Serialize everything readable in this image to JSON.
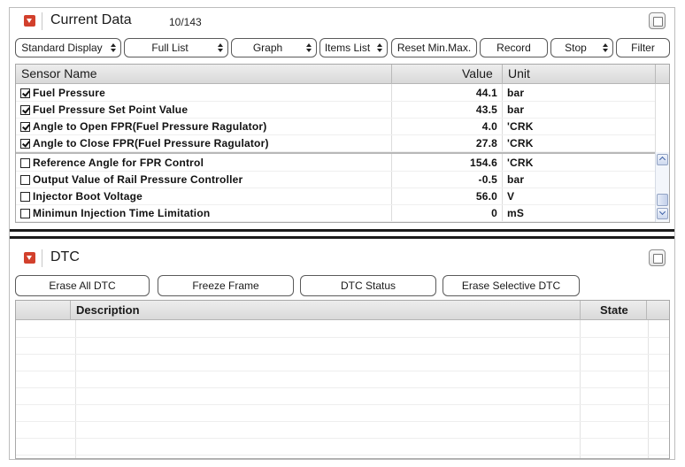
{
  "current_data": {
    "title": "Current Data",
    "count": "10/143",
    "toolbar": {
      "standard_display": "Standard Display",
      "full_list": "Full List",
      "graph": "Graph",
      "items_list": "Items List",
      "reset_min_max": "Reset Min.Max.",
      "record": "Record",
      "stop": "Stop",
      "filter": "Filter"
    },
    "columns": {
      "name": "Sensor Name",
      "value": "Value",
      "unit": "Unit"
    },
    "rows": [
      {
        "name": "Fuel Pressure",
        "value": "44.1",
        "unit": "bar",
        "checked": true
      },
      {
        "name": "Fuel Pressure Set Point Value",
        "value": "43.5",
        "unit": "bar",
        "checked": true
      },
      {
        "name": "Angle to Open FPR(Fuel Pressure Ragulator)",
        "value": "4.0",
        "unit": "'CRK",
        "checked": true
      },
      {
        "name": "Angle to Close FPR(Fuel Pressure Ragulator)",
        "value": "27.8",
        "unit": "'CRK",
        "checked": true
      },
      {
        "name": "Reference Angle for FPR Control",
        "value": "154.6",
        "unit": "'CRK",
        "checked": false
      },
      {
        "name": "Output Value of Rail Pressure Controller",
        "value": "-0.5",
        "unit": "bar",
        "checked": false
      },
      {
        "name": "Injector Boot Voltage",
        "value": "56.0",
        "unit": "V",
        "checked": false
      },
      {
        "name": "Minimun Injection Time Limitation",
        "value": "0",
        "unit": "mS",
        "checked": false
      }
    ]
  },
  "dtc": {
    "title": "DTC",
    "toolbar": {
      "erase_all": "Erase All DTC",
      "freeze_frame": "Freeze Frame",
      "dtc_status": "DTC Status",
      "erase_selective": "Erase Selective DTC"
    },
    "columns": {
      "description": "Description",
      "state": "State"
    }
  },
  "colors": {
    "collapse_button": "#d2402c",
    "header_gradient_top": "#ededed",
    "header_gradient_bottom": "#d9d9d9",
    "splitter": "#1c1c1c"
  },
  "icons": {
    "collapse": "chevron-down-icon",
    "maximize": "window-maximize-icon",
    "spinner": "up-down-spinner-icon",
    "scroll_up": "chevron-up-icon",
    "scroll_down": "chevron-down-icon",
    "checkbox": "checkbox-icon"
  }
}
